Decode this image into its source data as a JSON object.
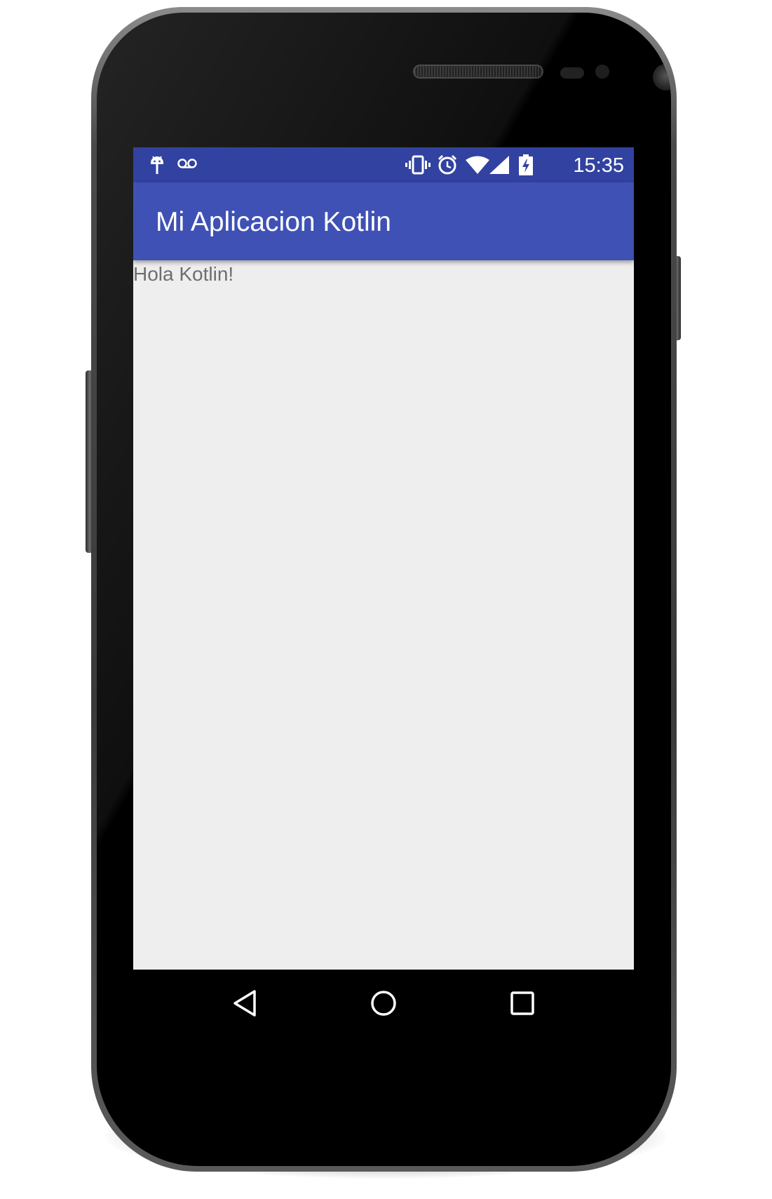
{
  "status_bar": {
    "left_icons": [
      "android-debug-icon",
      "voicemail-icon"
    ],
    "right_icons": [
      "vibrate-icon",
      "alarm-icon",
      "wifi-icon",
      "cell-signal-icon",
      "battery-charging-icon"
    ],
    "time": "15:35"
  },
  "app_bar": {
    "title": "Mi Aplicacion Kotlin"
  },
  "content": {
    "text": "Hola Kotlin!"
  },
  "nav_bar": {
    "buttons": [
      "back-icon",
      "home-icon",
      "recents-icon"
    ]
  },
  "colors": {
    "primary": "#3f51b5",
    "primary_dark": "#3242a0",
    "background": "#eeeeee",
    "body_text": "#6e6e6e"
  }
}
